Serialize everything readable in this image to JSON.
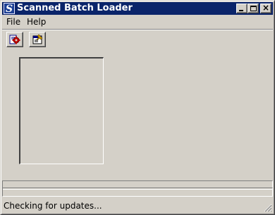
{
  "window": {
    "title": "Scanned Batch Loader",
    "app_icon_letter": "S"
  },
  "menu": {
    "items": [
      {
        "label": "File"
      },
      {
        "label": "Help"
      }
    ]
  },
  "toolbar": {
    "buttons": [
      {
        "icon": "scan-gear-icon"
      },
      {
        "icon": "settings-window-icon"
      }
    ]
  },
  "status": {
    "text": "Checking for updates..."
  },
  "colors": {
    "titlebar": "#0a246a",
    "face": "#d4d0c8"
  }
}
